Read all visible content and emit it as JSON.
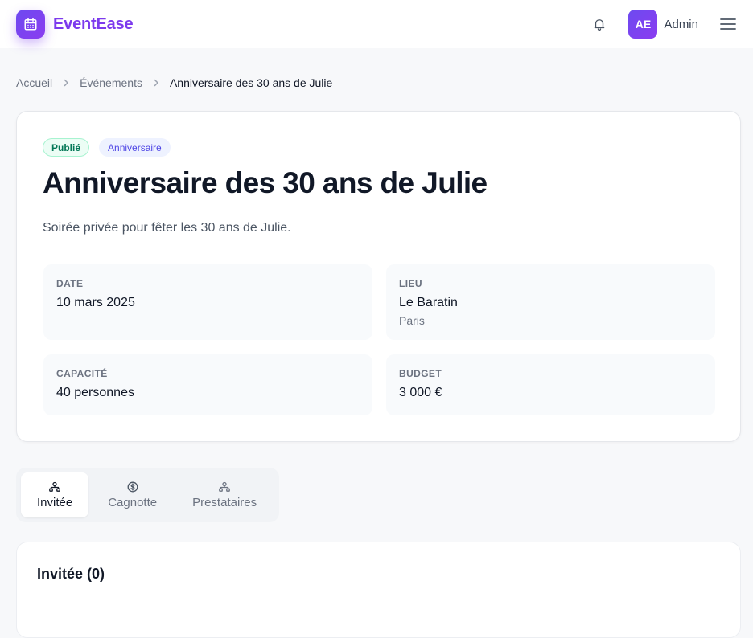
{
  "app": {
    "name": "EventEase"
  },
  "header": {
    "avatar_initials": "AE",
    "user_name": "Admin",
    "icons": [
      "calendar-icon",
      "bell-icon",
      "menu-icon"
    ]
  },
  "breadcrumb": {
    "home": "Accueil",
    "events": "Événements",
    "current": "Anniversaire des 30 ans de Julie"
  },
  "event": {
    "status": "Publié",
    "category": "Anniversaire",
    "title": "Anniversaire des 30 ans de Julie",
    "description": "Soirée privée pour fêter les 30 ans de Julie.",
    "date": {
      "label": "DATE",
      "value": "10 mars 2025"
    },
    "location": {
      "label": "LIEU",
      "value": "Le Baratin",
      "city": "Paris"
    },
    "capacity": {
      "label": "CAPACITÉ",
      "value": "40 personnes"
    },
    "budget": {
      "label": "BUDGET",
      "value": "3 000 €"
    }
  },
  "tabs": [
    {
      "label": "Invitée",
      "icon": "guests-icon",
      "active": true
    },
    {
      "label": "Cagnotte",
      "icon": "dollar-icon",
      "active": false
    },
    {
      "label": "Prestataires",
      "icon": "vendors-icon",
      "active": false
    }
  ],
  "guests_panel": {
    "title": "Invitée (0)"
  },
  "colors": {
    "brand": "#7c3aed",
    "published_bg": "#ecfdf5",
    "published_text": "#047857",
    "category_bg": "#eef2ff",
    "category_text": "#4f46e5"
  }
}
